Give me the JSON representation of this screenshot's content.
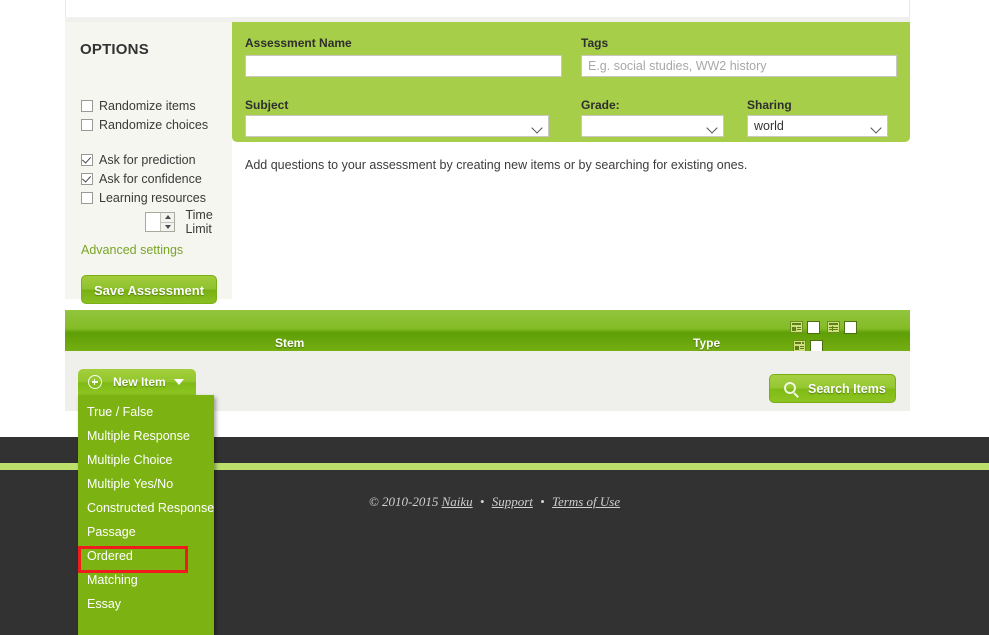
{
  "options_panel": {
    "title": "OPTIONS",
    "checkboxes": [
      {
        "label": "Randomize items",
        "checked": false
      },
      {
        "label": "Randomize choices",
        "checked": false
      },
      {
        "label": "Ask for prediction",
        "checked": true
      },
      {
        "label": "Ask for confidence",
        "checked": true
      },
      {
        "label": "Learning resources",
        "checked": false
      }
    ],
    "time_limit": {
      "label": "Time Limit",
      "value": ""
    },
    "advanced_settings_label": "Advanced settings",
    "save_button_label": "Save Assessment"
  },
  "form": {
    "assessment_name": {
      "label": "Assessment Name",
      "value": "",
      "placeholder": ""
    },
    "tags": {
      "label": "Tags",
      "value": "",
      "placeholder": "E.g. social studies, WW2 history"
    },
    "subject": {
      "label": "Subject",
      "value": ""
    },
    "grade": {
      "label": "Grade:",
      "value": ""
    },
    "sharing": {
      "label": "Sharing",
      "value": "world"
    },
    "hint": "Add questions to your assessment by creating new items or by searching for existing ones."
  },
  "items_table": {
    "columns": {
      "stem": "Stem",
      "type": "Type"
    },
    "header_icons": [
      "grid-view-icon",
      "grid-view-checkbox",
      "table-view-icon",
      "table-view-checkbox",
      "list-view-icon",
      "list-view-checkbox"
    ]
  },
  "toolbar": {
    "new_item_label": "New Item",
    "search_items_label": "Search Items"
  },
  "new_item_menu": {
    "items": [
      "True / False",
      "Multiple Response",
      "Multiple Choice",
      "Multiple Yes/No",
      "Constructed Response",
      "Passage",
      "Ordered",
      "Matching",
      "Essay"
    ],
    "highlighted_item": "Ordered"
  },
  "footer": {
    "copyright": "© 2010-2015",
    "brand": "Naiku",
    "separator": "•",
    "support": "Support",
    "terms": "Terms of Use"
  },
  "colors": {
    "brand_green": "#a6ce48",
    "menu_green": "#7cb312",
    "header_green": "#84bc27",
    "panel_bg": "#f4f6ef",
    "footer_dark": "#323232",
    "footer_stripe": "#bde06c",
    "highlight_red": "#ee1c1c"
  }
}
